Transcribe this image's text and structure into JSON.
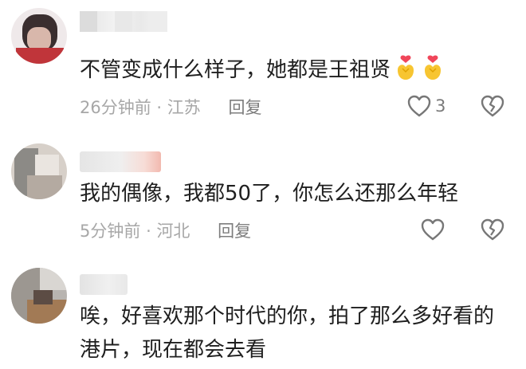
{
  "comments": [
    {
      "text": "不管变成什么样子，她都是王祖贤",
      "time": "26分钟前",
      "location": "江苏",
      "reply_label": "回复",
      "like_count": "3"
    },
    {
      "text": "我的偶像，我都50了，你怎么还那么年轻",
      "time": "5分钟前",
      "location": "河北",
      "reply_label": "回复",
      "like_count": ""
    },
    {
      "text": "唉，好喜欢那个时代的你，拍了那么多好看的港片，现在都会去看"
    }
  ],
  "meta_separator": "·",
  "icons": {
    "like": "heart-outline-icon",
    "dislike": "broken-heart-outline-icon",
    "emoji": "finger-heart-emoji"
  },
  "colors": {
    "text": "#1f1f1f",
    "meta": "#a7a7a7",
    "reply": "#7d7d7d",
    "icon": "#7a7a7a"
  }
}
